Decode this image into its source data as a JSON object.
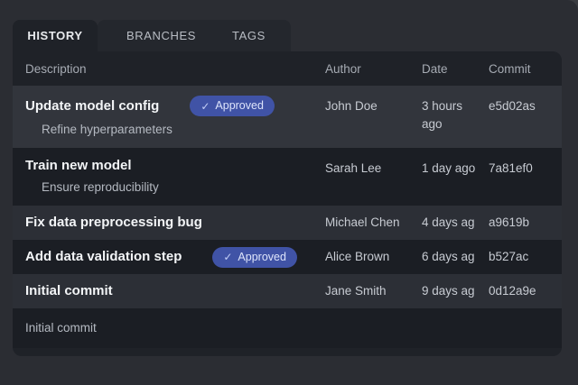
{
  "tabs": {
    "active": "HISTORY",
    "items": [
      {
        "label": "HISTORY"
      },
      {
        "label": "BRANCHES"
      },
      {
        "label": "TAGS"
      }
    ]
  },
  "table": {
    "headers": {
      "description": "Description",
      "author": "Author",
      "date": "Date",
      "commit": "Commit"
    },
    "rows": [
      {
        "title": "Update model config",
        "subtitle": "Refine hyperparameters",
        "badge_icon": "✓",
        "badge_label": "Approved",
        "author": "John Doe",
        "date": "3 hours ago",
        "commit": "e5d02as"
      },
      {
        "title": "Train new model",
        "subtitle": "Ensure reproducibility",
        "author": "Sarah Lee",
        "date": "1 day ago",
        "commit": "7a81ef0"
      },
      {
        "title": "Fix data preprocessing bug",
        "author": "Michael Chen",
        "date": "4 days ag",
        "commit": "a9619b"
      },
      {
        "title": "Add data validation step",
        "badge_icon": "✓",
        "badge_label": "Approved",
        "author": "Alice Brown",
        "date": "6 days ag",
        "commit": "b527ac"
      },
      {
        "title": "Initial commit",
        "author": "Jane Smith",
        "date": "9 days ag",
        "commit": "0d12a9e"
      },
      {
        "title": "Initial commit"
      }
    ]
  },
  "colors": {
    "page_bg": "#2b2d33",
    "panel_bg": "#1f2228",
    "row_dark": "#1b1e24",
    "row_light": "#2c2f36",
    "row_selected": "#32353c",
    "badge_bg": "#4053a6",
    "badge_text": "#dde4fb"
  }
}
